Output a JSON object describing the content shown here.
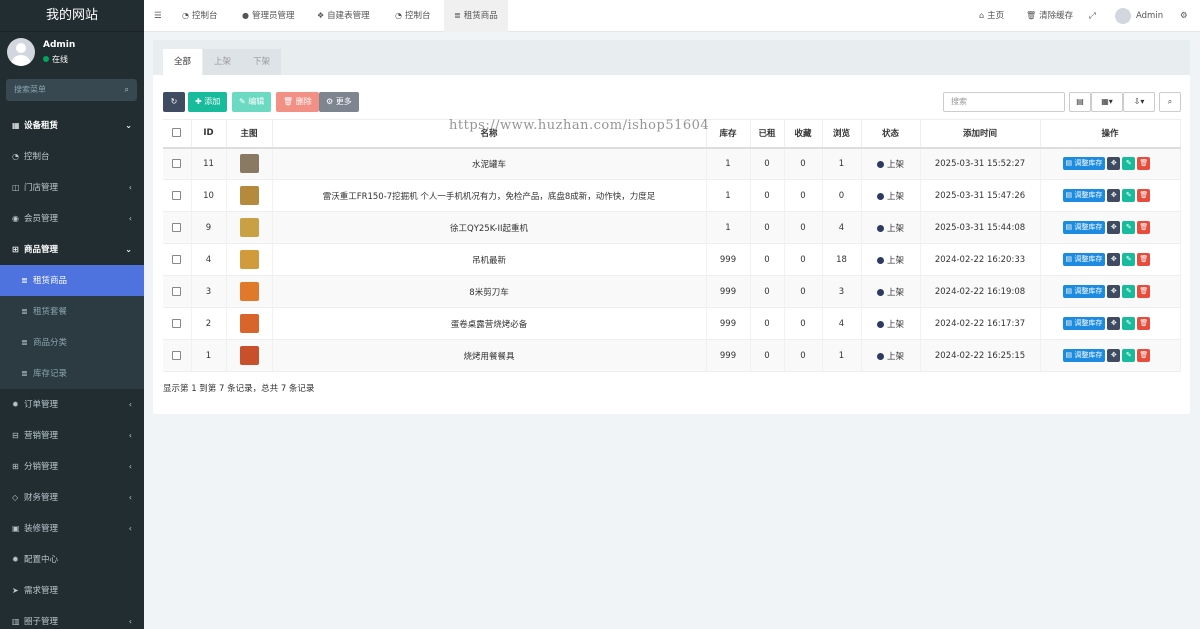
{
  "sidebar": {
    "brand": "我的网站",
    "user_name": "Admin",
    "user_status": "在线",
    "search_placeholder": "搜索菜单",
    "items": [
      {
        "label": "设备租赁",
        "icon": "th-large-icon",
        "type": "header",
        "arrow": "⌄"
      },
      {
        "label": "控制台",
        "icon": "dashboard-icon",
        "type": "item",
        "arrow": ""
      },
      {
        "label": "门店管理",
        "icon": "store-icon",
        "type": "item",
        "arrow": "‹"
      },
      {
        "label": "会员管理",
        "icon": "user-circle-icon",
        "type": "item",
        "arrow": "‹"
      },
      {
        "label": "商品管理",
        "icon": "sitemap-icon",
        "type": "header",
        "arrow": "⌄"
      },
      {
        "label": "租赁商品",
        "icon": "list-icon",
        "type": "active",
        "arrow": ""
      },
      {
        "label": "租赁套餐",
        "icon": "list-icon",
        "type": "sub",
        "arrow": ""
      },
      {
        "label": "商品分类",
        "icon": "list-icon",
        "type": "sub",
        "arrow": ""
      },
      {
        "label": "库存记录",
        "icon": "list-icon",
        "type": "sub",
        "arrow": ""
      },
      {
        "label": "订单管理",
        "icon": "gear-icon",
        "type": "item",
        "arrow": "‹"
      },
      {
        "label": "营销管理",
        "icon": "gift-icon",
        "type": "item",
        "arrow": "‹"
      },
      {
        "label": "分销管理",
        "icon": "sitemap-icon",
        "type": "item",
        "arrow": "‹"
      },
      {
        "label": "财务管理",
        "icon": "diamond-icon",
        "type": "item",
        "arrow": "‹"
      },
      {
        "label": "装修管理",
        "icon": "layout-icon",
        "type": "item",
        "arrow": "‹"
      },
      {
        "label": "配置中心",
        "icon": "gear-icon",
        "type": "item",
        "arrow": ""
      },
      {
        "label": "需求管理",
        "icon": "send-icon",
        "type": "item",
        "arrow": ""
      },
      {
        "label": "圈子管理",
        "icon": "book-icon",
        "type": "item",
        "arrow": "‹"
      }
    ]
  },
  "topbar": {
    "tabs": [
      {
        "label": "控制台",
        "icon": "dashboard-icon"
      },
      {
        "label": "管理员管理",
        "icon": "user-icon"
      },
      {
        "label": "自建表管理",
        "icon": "cubes-icon"
      },
      {
        "label": "控制台",
        "icon": "dashboard-icon"
      },
      {
        "label": "租赁商品",
        "icon": "list-icon"
      }
    ],
    "home_label": "主页",
    "clear_cache_label": "清除缓存",
    "admin_label": "Admin"
  },
  "filter_tabs": [
    "全部",
    "上架",
    "下架"
  ],
  "toolbar": {
    "add_label": "添加",
    "edit_label": "编辑",
    "delete_label": "删除",
    "more_label": "更多",
    "search_placeholder": "搜索"
  },
  "table": {
    "headers": [
      "ID",
      "主图",
      "名称",
      "库存",
      "已租",
      "收藏",
      "浏览",
      "状态",
      "添加时间",
      "操作"
    ],
    "rows": [
      {
        "id": "11",
        "name": "水泥罐车",
        "stock": "1",
        "rented": "0",
        "fav": "0",
        "views": "1",
        "status": "上架",
        "time": "2025-03-31 15:52:27",
        "thumb": "#8a7a64"
      },
      {
        "id": "10",
        "name": "雷沃重工FR150-7挖掘机 个人一手机机况有力，免检产品，底盘8成新，动作快，力度足",
        "stock": "1",
        "rented": "0",
        "fav": "0",
        "views": "0",
        "status": "上架",
        "time": "2025-03-31 15:47:26",
        "thumb": "#b58a3c"
      },
      {
        "id": "9",
        "name": "徐工QY25K-II起重机",
        "stock": "1",
        "rented": "0",
        "fav": "0",
        "views": "4",
        "status": "上架",
        "time": "2025-03-31 15:44:08",
        "thumb": "#c9a043"
      },
      {
        "id": "4",
        "name": "吊机最新",
        "stock": "999",
        "rented": "0",
        "fav": "0",
        "views": "18",
        "status": "上架",
        "time": "2024-02-22 16:20:33",
        "thumb": "#d19a3a"
      },
      {
        "id": "3",
        "name": "8米剪刀车",
        "stock": "999",
        "rented": "0",
        "fav": "0",
        "views": "3",
        "status": "上架",
        "time": "2024-02-22 16:19:08",
        "thumb": "#e07a2a"
      },
      {
        "id": "2",
        "name": "蛋卷桌露营烧烤必备",
        "stock": "999",
        "rented": "0",
        "fav": "0",
        "views": "4",
        "status": "上架",
        "time": "2024-02-22 16:17:37",
        "thumb": "#d8662a"
      },
      {
        "id": "1",
        "name": "烧烤用餐餐具",
        "stock": "999",
        "rented": "0",
        "fav": "0",
        "views": "1",
        "status": "上架",
        "time": "2024-02-22 16:25:15",
        "thumb": "#c8502a"
      }
    ],
    "op_label": "调整库存"
  },
  "pagination_info": "显示第 1 到第 7 条记录，总共 7 条记录",
  "watermark": "https://www.huzhan.com/ishop51604",
  "colors": {
    "accent": "#4e73df",
    "sidebar_bg": "#222d32",
    "add": "#18bc9c",
    "edit": "#6cd9c3",
    "delete": "#f39085",
    "more": "#7d8591",
    "refresh": "#3f4b60"
  }
}
